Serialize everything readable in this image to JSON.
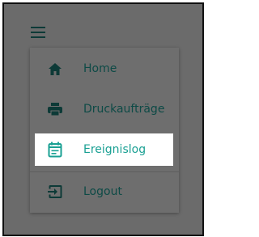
{
  "menu": {
    "items": [
      {
        "label": "Home",
        "icon": "home-icon"
      },
      {
        "label": "Druckaufträge",
        "icon": "printer-icon"
      },
      {
        "label": "Ereignislog",
        "icon": "event-log-icon",
        "active": true
      },
      {
        "label": "Logout",
        "icon": "logout-icon"
      }
    ]
  },
  "colors": {
    "overlay": "#6b6b6b",
    "text_dim": "#0d4a46",
    "accent": "#1aa093",
    "highlight": "#ffffff"
  }
}
